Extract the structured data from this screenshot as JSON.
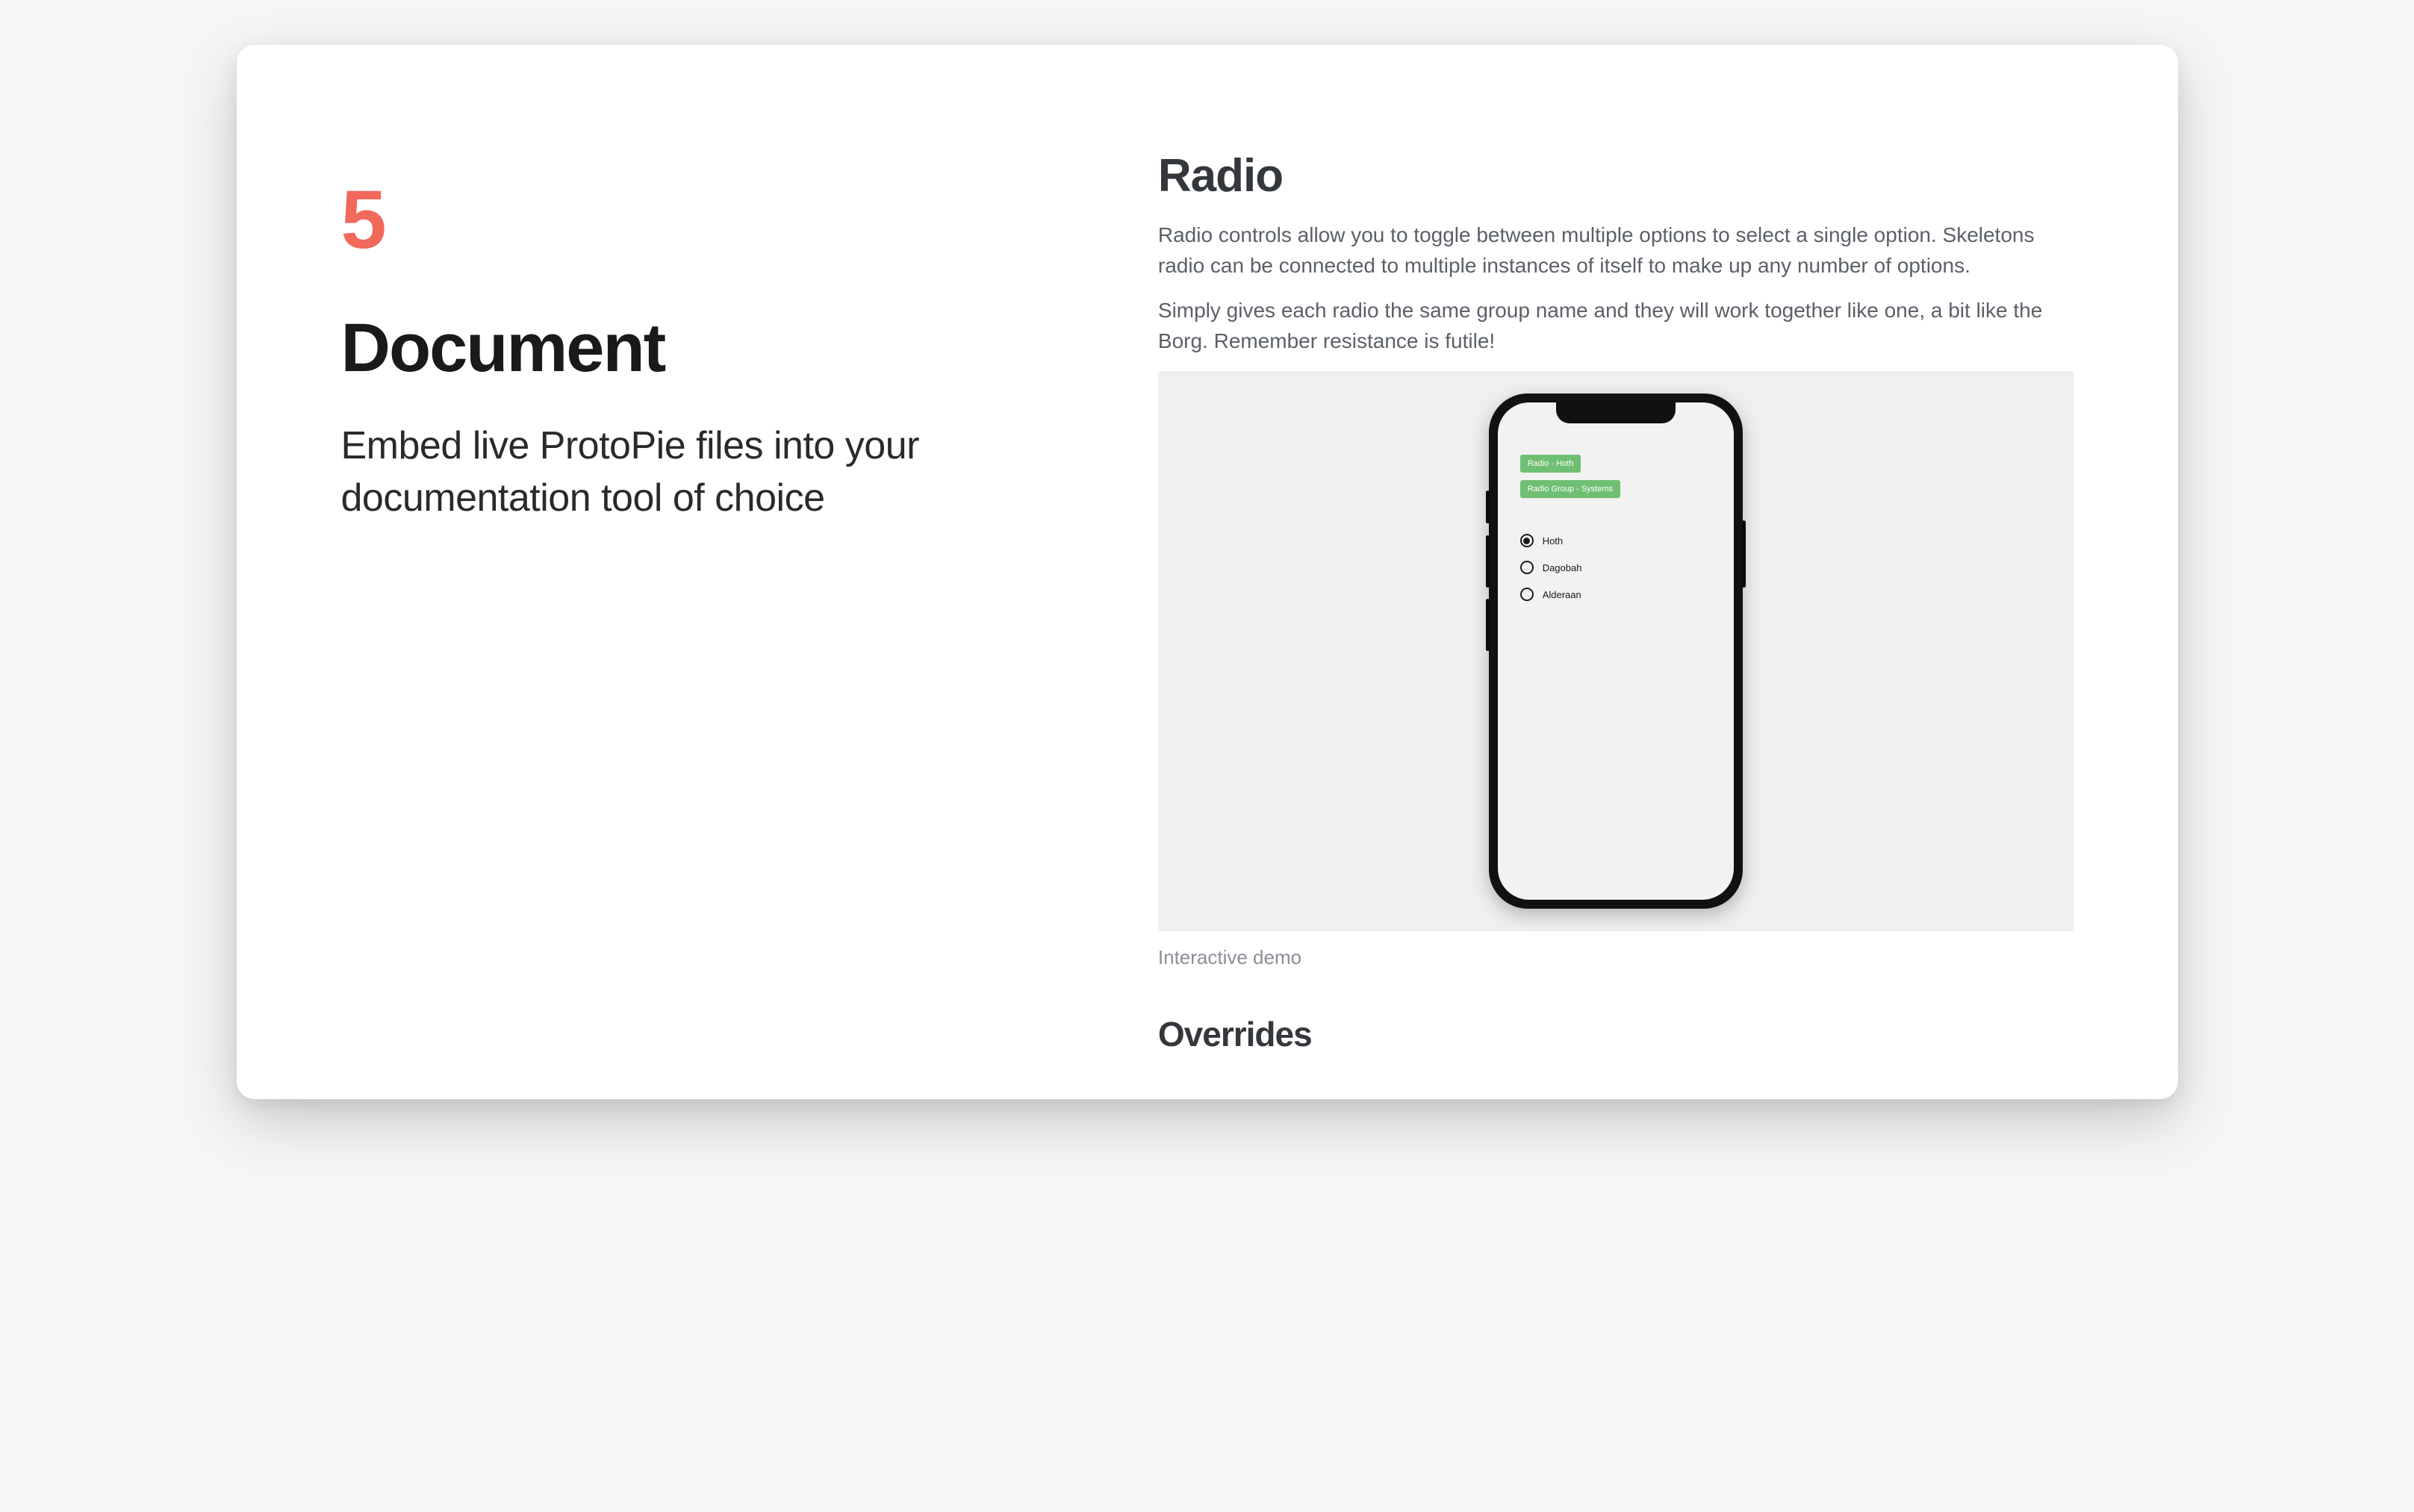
{
  "slide": {
    "step": "5",
    "title": "Document",
    "description": "Embed live ProtoPie files into your documentation tool of choice"
  },
  "doc": {
    "title": "Radio",
    "para1": "Radio controls allow you to toggle between multiple options to select a single option. Skeletons radio can be connected to multiple instances of itself to make up any number of options.",
    "para2": "Simply gives each radio the same group name and they will work together like one, a bit like the Borg. Remember resistance is futile!",
    "demo_caption": "Interactive demo",
    "sub_heading": "Overrides"
  },
  "demo": {
    "chip1": "Radio - Hoth",
    "chip2": "Radio Group - Systems",
    "options": [
      {
        "label": "Hoth",
        "selected": true
      },
      {
        "label": "Dagobah",
        "selected": false
      },
      {
        "label": "Alderaan",
        "selected": false
      }
    ]
  }
}
